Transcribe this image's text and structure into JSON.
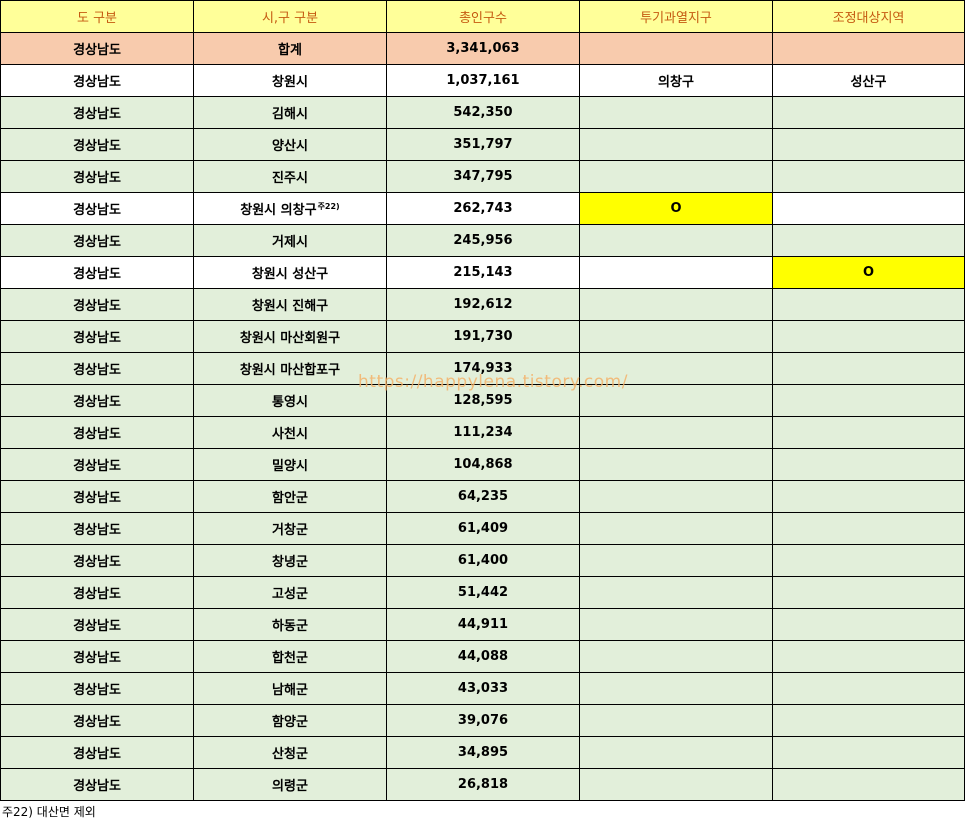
{
  "headers": [
    "도 구분",
    "시,구 구분",
    "총인구수",
    "투기과열지구",
    "조정대상지역"
  ],
  "rows": [
    {
      "province": "경상남도",
      "city": "합계",
      "sup": "",
      "population": "3,341,063",
      "speculation": "",
      "adjustment": "",
      "style": "total",
      "spec_hl": false,
      "adj_hl": false
    },
    {
      "province": "경상남도",
      "city": "창원시",
      "sup": "",
      "population": "1,037,161",
      "speculation": "의창구",
      "adjustment": "성산구",
      "style": "white",
      "spec_hl": false,
      "adj_hl": false
    },
    {
      "province": "경상남도",
      "city": "김해시",
      "sup": "",
      "population": "542,350",
      "speculation": "",
      "adjustment": "",
      "style": "green",
      "spec_hl": false,
      "adj_hl": false
    },
    {
      "province": "경상남도",
      "city": "양산시",
      "sup": "",
      "population": "351,797",
      "speculation": "",
      "adjustment": "",
      "style": "green",
      "spec_hl": false,
      "adj_hl": false
    },
    {
      "province": "경상남도",
      "city": "진주시",
      "sup": "",
      "population": "347,795",
      "speculation": "",
      "adjustment": "",
      "style": "green",
      "spec_hl": false,
      "adj_hl": false
    },
    {
      "province": "경상남도",
      "city": "창원시 의창구",
      "sup": "주22)",
      "population": "262,743",
      "speculation": "O",
      "adjustment": "",
      "style": "white",
      "spec_hl": true,
      "adj_hl": false
    },
    {
      "province": "경상남도",
      "city": "거제시",
      "sup": "",
      "population": "245,956",
      "speculation": "",
      "adjustment": "",
      "style": "green",
      "spec_hl": false,
      "adj_hl": false
    },
    {
      "province": "경상남도",
      "city": "창원시 성산구",
      "sup": "",
      "population": "215,143",
      "speculation": "",
      "adjustment": "O",
      "style": "white",
      "spec_hl": false,
      "adj_hl": true
    },
    {
      "province": "경상남도",
      "city": "창원시 진해구",
      "sup": "",
      "population": "192,612",
      "speculation": "",
      "adjustment": "",
      "style": "green",
      "spec_hl": false,
      "adj_hl": false
    },
    {
      "province": "경상남도",
      "city": "창원시 마산회원구",
      "sup": "",
      "population": "191,730",
      "speculation": "",
      "adjustment": "",
      "style": "green",
      "spec_hl": false,
      "adj_hl": false
    },
    {
      "province": "경상남도",
      "city": "창원시 마산합포구",
      "sup": "",
      "population": "174,933",
      "speculation": "",
      "adjustment": "",
      "style": "green",
      "spec_hl": false,
      "adj_hl": false
    },
    {
      "province": "경상남도",
      "city": "통영시",
      "sup": "",
      "population": "128,595",
      "speculation": "",
      "adjustment": "",
      "style": "green",
      "spec_hl": false,
      "adj_hl": false
    },
    {
      "province": "경상남도",
      "city": "사천시",
      "sup": "",
      "population": "111,234",
      "speculation": "",
      "adjustment": "",
      "style": "green",
      "spec_hl": false,
      "adj_hl": false
    },
    {
      "province": "경상남도",
      "city": "밀양시",
      "sup": "",
      "population": "104,868",
      "speculation": "",
      "adjustment": "",
      "style": "green",
      "spec_hl": false,
      "adj_hl": false
    },
    {
      "province": "경상남도",
      "city": "함안군",
      "sup": "",
      "population": "64,235",
      "speculation": "",
      "adjustment": "",
      "style": "green",
      "spec_hl": false,
      "adj_hl": false
    },
    {
      "province": "경상남도",
      "city": "거창군",
      "sup": "",
      "population": "61,409",
      "speculation": "",
      "adjustment": "",
      "style": "green",
      "spec_hl": false,
      "adj_hl": false
    },
    {
      "province": "경상남도",
      "city": "창녕군",
      "sup": "",
      "population": "61,400",
      "speculation": "",
      "adjustment": "",
      "style": "green",
      "spec_hl": false,
      "adj_hl": false
    },
    {
      "province": "경상남도",
      "city": "고성군",
      "sup": "",
      "population": "51,442",
      "speculation": "",
      "adjustment": "",
      "style": "green",
      "spec_hl": false,
      "adj_hl": false
    },
    {
      "province": "경상남도",
      "city": "하동군",
      "sup": "",
      "population": "44,911",
      "speculation": "",
      "adjustment": "",
      "style": "green",
      "spec_hl": false,
      "adj_hl": false
    },
    {
      "province": "경상남도",
      "city": "합천군",
      "sup": "",
      "population": "44,088",
      "speculation": "",
      "adjustment": "",
      "style": "green",
      "spec_hl": false,
      "adj_hl": false
    },
    {
      "province": "경상남도",
      "city": "남해군",
      "sup": "",
      "population": "43,033",
      "speculation": "",
      "adjustment": "",
      "style": "green",
      "spec_hl": false,
      "adj_hl": false
    },
    {
      "province": "경상남도",
      "city": "함양군",
      "sup": "",
      "population": "39,076",
      "speculation": "",
      "adjustment": "",
      "style": "green",
      "spec_hl": false,
      "adj_hl": false
    },
    {
      "province": "경상남도",
      "city": "산청군",
      "sup": "",
      "population": "34,895",
      "speculation": "",
      "adjustment": "",
      "style": "green",
      "spec_hl": false,
      "adj_hl": false
    },
    {
      "province": "경상남도",
      "city": "의령군",
      "sup": "",
      "population": "26,818",
      "speculation": "",
      "adjustment": "",
      "style": "green",
      "spec_hl": false,
      "adj_hl": false
    }
  ],
  "watermark": "https://happylena.tistory.com/",
  "footnote": "주22) 대산면 제외",
  "colors": {
    "header_bg": "#ffff99",
    "header_text": "#c55a11",
    "total_bg": "#f8cbad",
    "row_bg": "#e2efda",
    "highlight": "#ffff00"
  }
}
